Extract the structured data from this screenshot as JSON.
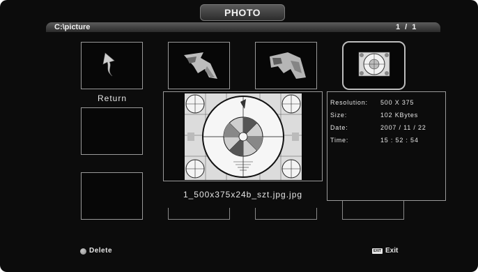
{
  "header": {
    "title": "PHOTO"
  },
  "path_bar": {
    "path": "C:\\picture",
    "page": "1 / 1"
  },
  "thumbnails": [
    {
      "kind": "return",
      "label": "Return",
      "icon": "return-arrow-icon"
    },
    {
      "kind": "image",
      "icon": "photo-thumbnail-icon"
    },
    {
      "kind": "image",
      "icon": "photo-thumbnail-icon"
    },
    {
      "kind": "image",
      "icon": "test-pattern-thumbnail-icon",
      "selected": true
    }
  ],
  "preview": {
    "filename": "1_500x375x24b_szt.jpg.jpg",
    "image": "test-pattern-image"
  },
  "info": {
    "resolution_label": "Resolution:",
    "resolution_value": "500 X 375",
    "size_label": "Size:",
    "size_value": "102 KBytes",
    "date_label": "Date:",
    "date_value": "2007 / 11 / 22",
    "time_label": "Time:",
    "time_value": "15 : 52 : 54"
  },
  "footer": {
    "delete_label": "Delete",
    "delete_color": "#8a8a8a",
    "exit_key": "EXIT",
    "exit_label": "Exit"
  }
}
